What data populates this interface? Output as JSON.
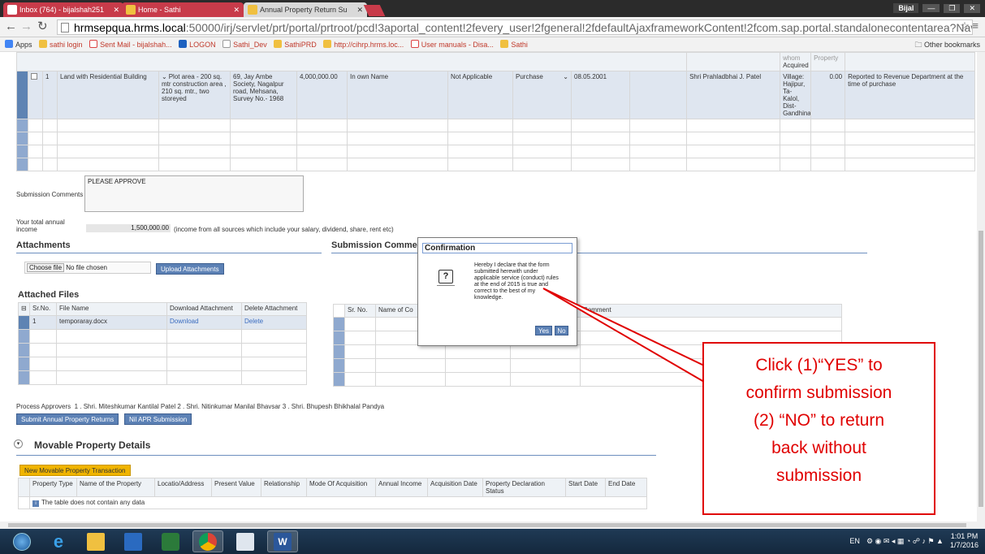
{
  "browser": {
    "tabs": [
      {
        "label": "Inbox (764) - bijalshah251",
        "icon": "gmail-icon"
      },
      {
        "label": "Home - Sathi",
        "icon": "sathi-icon"
      },
      {
        "label": "Annual Property Return Su",
        "icon": "sathi-icon"
      }
    ],
    "user": "Bijal",
    "url_host": "hrmsepqua.hrms.local",
    "url_rest": ":50000/irj/servlet/prt/portal/prtroot/pcd!3aportal_content!2fevery_user!2fgeneral!2fdefaultAjaxframeworkContent!2fcom.sap.portal.standalonecontentarea?NavigationTarget=nav",
    "bookmarks": [
      "Apps",
      "sathi login",
      "Sent Mail - bijalshah...",
      "LOGON",
      "Sathi_Dev",
      "SathiPRD",
      "http://cihrp.hrms.loc...",
      "User manuals - Disa...",
      "Sathi"
    ],
    "other_bookmarks": "Other bookmarks"
  },
  "property_table": {
    "header_partial": {
      "acquired_label": "Acquired",
      "whom": "whom",
      "property": "Property"
    },
    "row": {
      "sr": "1",
      "type": "Land with Residential Building",
      "description": "Plot area - 200 sq. mtr construction area , 210 sq. mtr., two storeyed",
      "address": "69, Jay Ambe Society, Nagalpur road, Mehsana, Survey No.- 1968",
      "value": "4,000,000.00",
      "ownership": "In own Name",
      "relationship": "Not Applicable",
      "mode": "Purchase",
      "date": "08.05.2001",
      "acquired_from": "Shri Prahladbhai J. Patel",
      "from_address": "Village: Hajipur, Ta- Kalol, Dist- Gandhina",
      "income": "0.00",
      "remarks": "Reported to Revenue Department at the time of purchase"
    }
  },
  "submission": {
    "comments_label": "Submission Comments",
    "comments_value": "PLEASE APPROVE",
    "income_label": "Your total annual income",
    "income_value": "1,500,000.00",
    "income_note": "(income from all sources which include your salary, dividend, share, rent etc)"
  },
  "attachments": {
    "title": "Attachments",
    "choose_file": "Choose file",
    "no_file": "No file chosen",
    "upload_button": "Upload Attachments",
    "attached_title": "Attached Files",
    "headers": [
      "Sr.No.",
      "File Name",
      "Download Attachment",
      "Delete Attachment"
    ],
    "rows": [
      {
        "sr": "1",
        "file": "temporaray.docx",
        "download": "Download",
        "delete": "Delete"
      }
    ]
  },
  "submission_comments": {
    "title": "Submission Comments",
    "headers": [
      "Sr. No.",
      "Name of Co",
      "",
      "",
      "Comment"
    ]
  },
  "approvers": {
    "label": "Process Approvers",
    "text": "1 . Shri. Miteshkumar Kantilal Patel 2 . Shri. Nitinkumar Manilal Bhavsar 3 . Shri. Bhupesh Bhikhalal Pandya",
    "submit_button": "Submit Annual Property Returns",
    "nil_button": "Nil APR Submission"
  },
  "movable": {
    "title": "Movable Property Details",
    "new_button": "New Movable Property Transaction",
    "headers": [
      "Property Type",
      "Name of the Property",
      "Locatio/Address",
      "Present Value",
      "Relationship",
      "Mode Of Acquisition",
      "Annual Income",
      "Acquisition Date",
      "Property Declaration Status",
      "Start Date",
      "End Date"
    ],
    "empty": "The table does not contain any data"
  },
  "dialog": {
    "title": "Confirmation",
    "message": "Hereby I declare that the form submitted herewith under applicable service (conduct) rules at the end of 2015 is true and correct to the best of my knowledge.",
    "yes": "Yes",
    "no": "No"
  },
  "callout": {
    "line1": "Click (1)“YES” to",
    "line2": "confirm submission",
    "line3": "(2) “NO” to return",
    "line4": "back without",
    "line5": "submission",
    "color": "#e00000"
  },
  "taskbar": {
    "lang": "EN",
    "time": "1:01 PM",
    "date": "1/7/2016"
  }
}
